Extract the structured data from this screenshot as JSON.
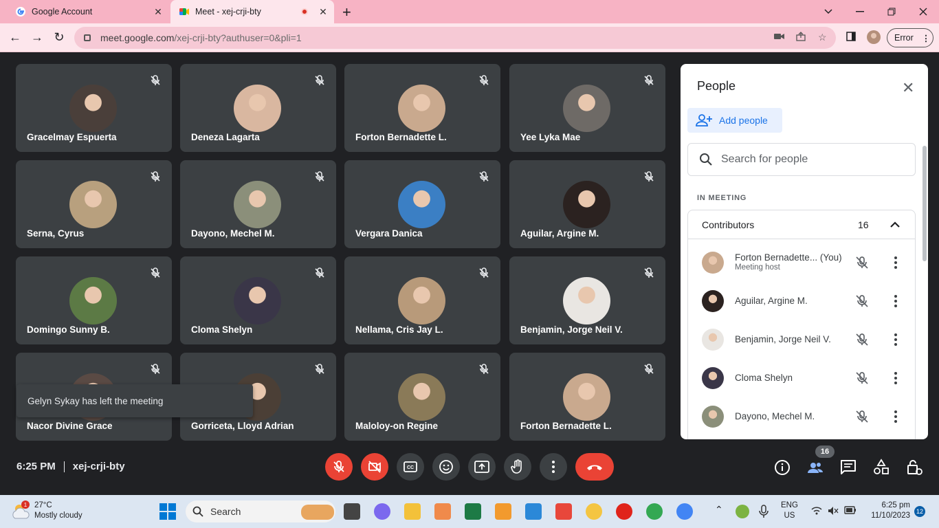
{
  "browser": {
    "tabs": [
      {
        "title": "Google Account",
        "close": "✕"
      },
      {
        "title": "Meet - xej-crji-bty",
        "close": "✕"
      }
    ],
    "url_host": "meet.google.com",
    "url_path": "/xej-crji-bty?authuser=0&pli=1",
    "profile_button": "Error"
  },
  "tiles": [
    {
      "name": "Gracelmay Espuerta",
      "color": "#4a3f3a"
    },
    {
      "name": "Deneza Lagarta",
      "color": "#d9b7a0"
    },
    {
      "name": "Forton Bernadette L.",
      "color": "#c9a98e"
    },
    {
      "name": "Yee Lyka Mae",
      "color": "#6e6a66"
    },
    {
      "name": "Serna, Cyrus",
      "color": "#b8a07e"
    },
    {
      "name": "Dayono, Mechel M.",
      "color": "#8b8f7a"
    },
    {
      "name": "Vergara Danica",
      "color": "#3b7fc4"
    },
    {
      "name": "Aguilar, Argine M.",
      "color": "#2b2220"
    },
    {
      "name": "Domingo Sunny B.",
      "color": "#5c7a45"
    },
    {
      "name": "Cloma Shelyn",
      "color": "#3a3648"
    },
    {
      "name": "Nellama, Cris Jay L.",
      "color": "#b89a7a"
    },
    {
      "name": "Benjamin, Jorge Neil V.",
      "color": "#e9e6e2"
    },
    {
      "name": "Nacor Divine Grace",
      "color": "#5a4a44"
    },
    {
      "name": "Gorriceta, Lloyd Adrian",
      "color": "#4b3f36"
    },
    {
      "name": "Maloloy-on Regine",
      "color": "#8a7a58"
    },
    {
      "name": "Forton Bernadette L.",
      "color": "#c9a98e"
    }
  ],
  "toast": "Gelyn Sykay has left the meeting",
  "people_panel": {
    "title": "People",
    "add_people": "Add people",
    "search_placeholder": "Search for people",
    "section": "IN MEETING",
    "group_label": "Contributors",
    "group_count": "16",
    "participants": [
      {
        "name": "Forton Bernadette...  (You)",
        "sub": "Meeting host",
        "color": "#c9a98e"
      },
      {
        "name": "Aguilar, Argine M.",
        "sub": "",
        "color": "#2b2220"
      },
      {
        "name": "Benjamin, Jorge Neil V.",
        "sub": "",
        "color": "#e9e6e2"
      },
      {
        "name": "Cloma Shelyn",
        "sub": "",
        "color": "#3a3648"
      },
      {
        "name": "Dayono, Mechel M.",
        "sub": "",
        "color": "#8b8f7a"
      }
    ]
  },
  "meeting_bar": {
    "time": "6:25 PM",
    "code": "xej-crji-bty",
    "people_count": "16"
  },
  "taskbar": {
    "weather_badge": "1",
    "temp": "27°C",
    "condition": "Mostly cloudy",
    "search": "Search",
    "lang": "ENG",
    "region": "US",
    "time": "6:25 pm",
    "date": "11/10/2023",
    "notif_count": "12"
  },
  "colors": {
    "accent": "#1a73e8",
    "danger": "#ea4335",
    "tile": "#3c4043",
    "bg": "#202124",
    "tabstrip": "#f7b3c4"
  }
}
